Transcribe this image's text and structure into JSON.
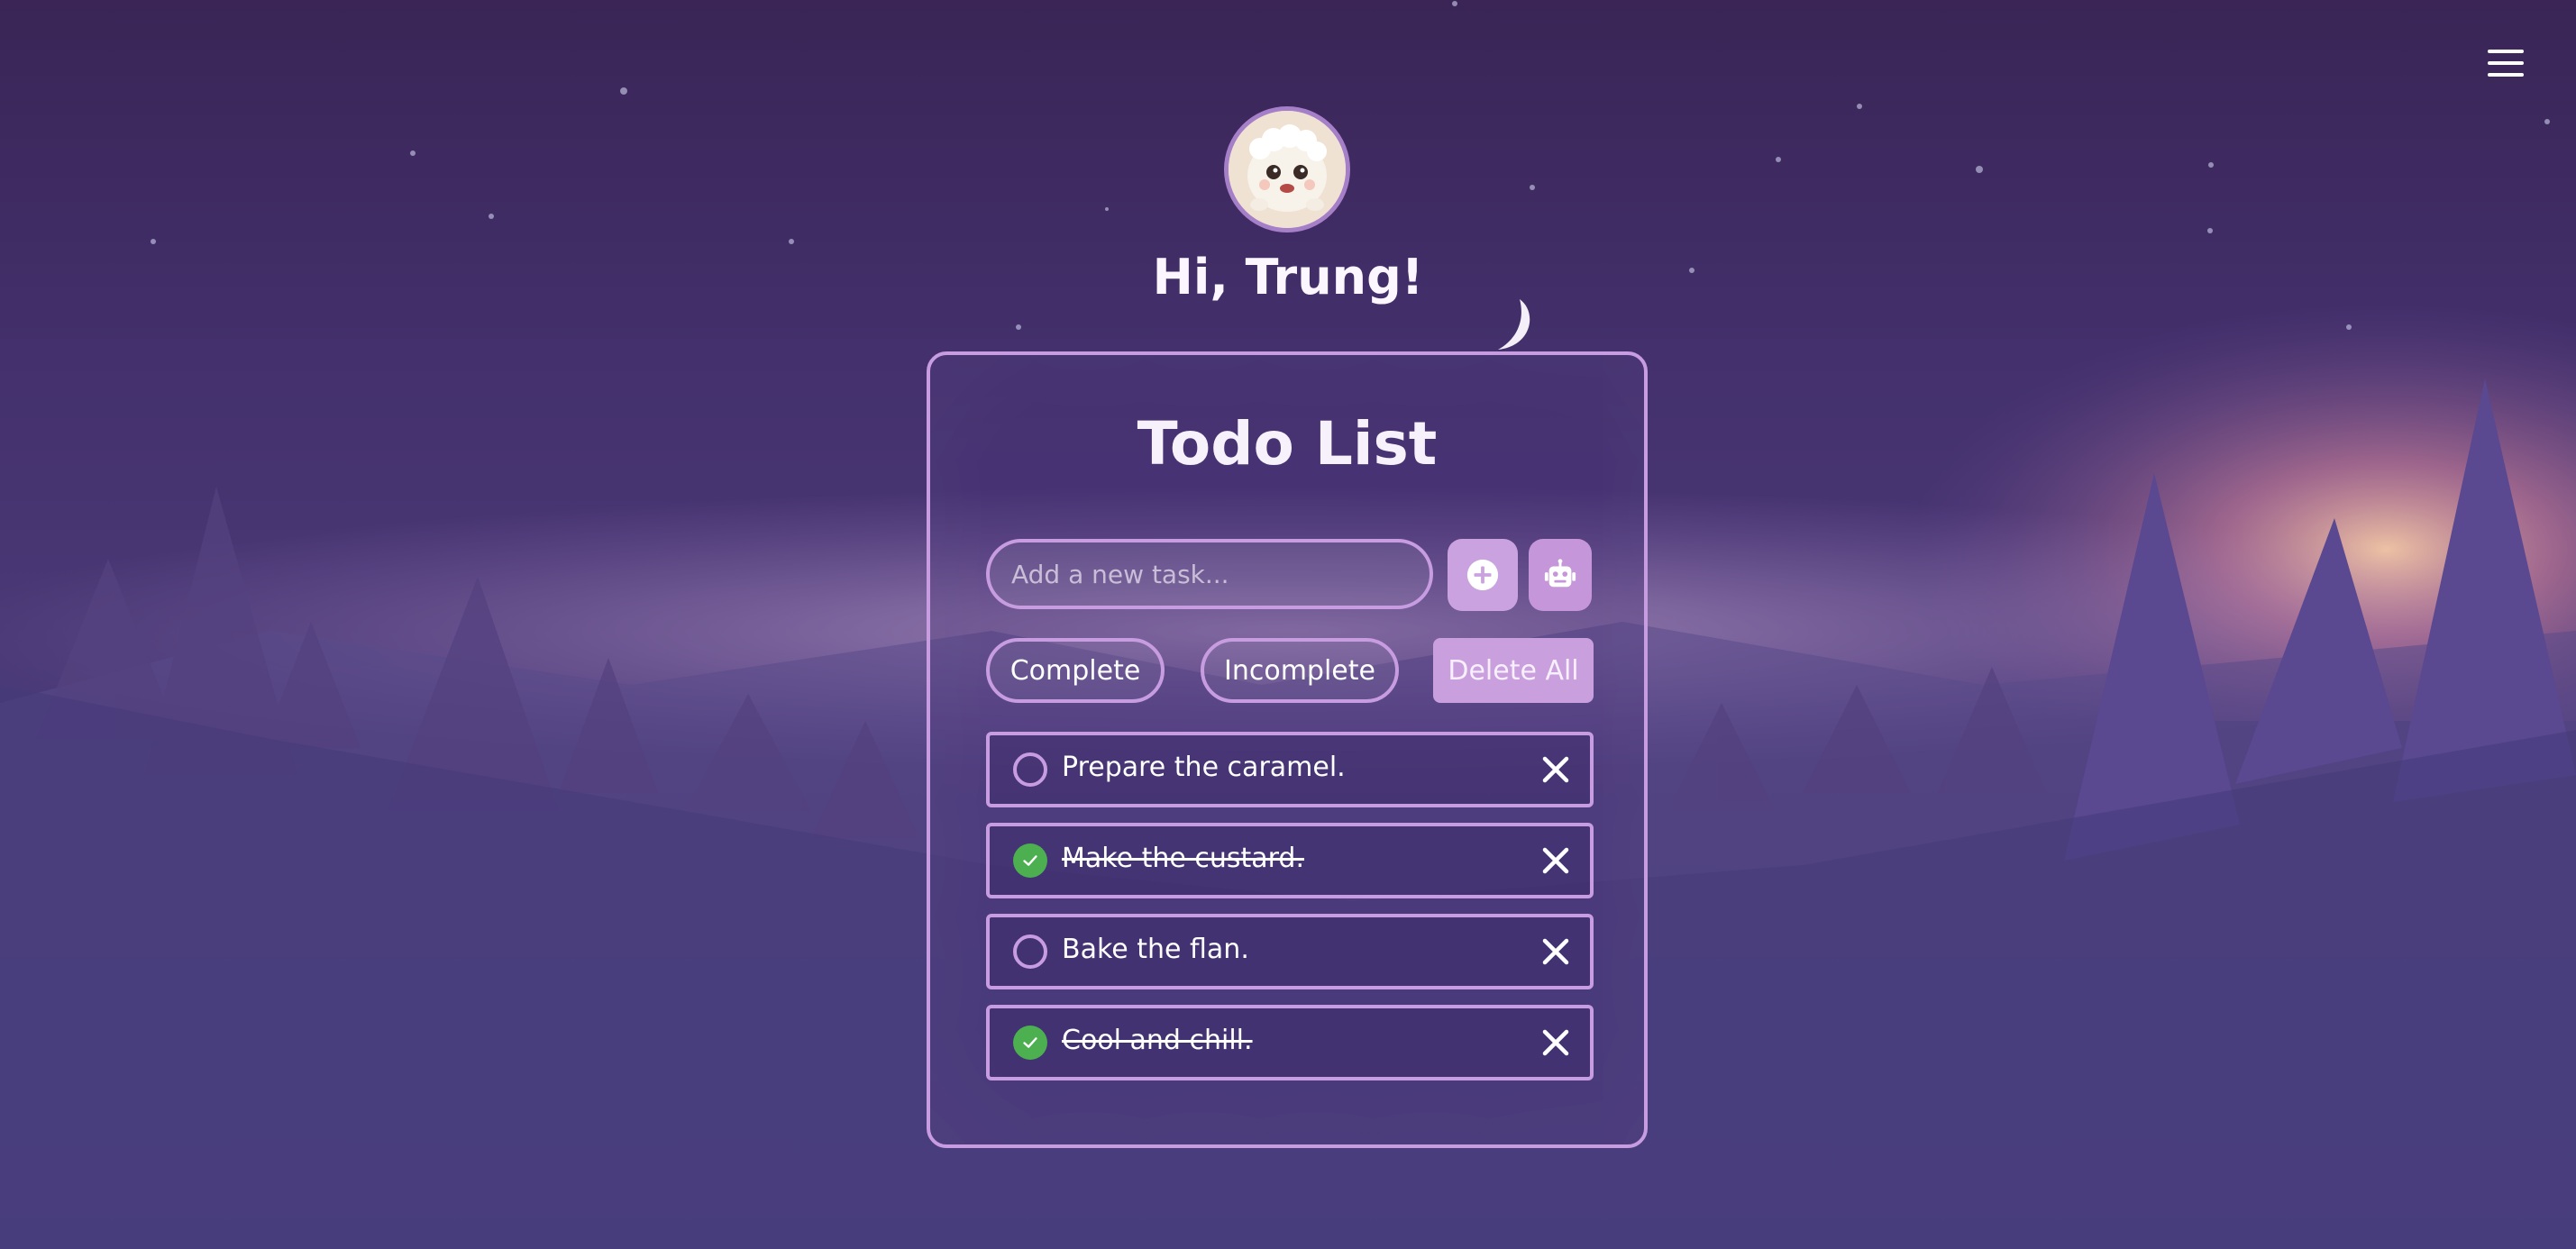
{
  "header": {
    "greeting": "Hi, Trung!",
    "menu_icon": "hamburger-icon"
  },
  "avatar": {
    "icon": "avatar-image"
  },
  "todo": {
    "title": "Todo List",
    "input_placeholder": "Add a new task...",
    "input_value": "",
    "add_icon": "plus-circle-icon",
    "ai_icon": "robot-icon"
  },
  "filters": {
    "complete_label": "Complete",
    "incomplete_label": "Incomplete",
    "delete_all_label": "Delete All"
  },
  "tasks": [
    {
      "text": "Prepare the caramel.",
      "completed": false
    },
    {
      "text": "Make the custard.",
      "completed": true
    },
    {
      "text": "Bake the flan.",
      "completed": false
    },
    {
      "text": "Cool and chill.",
      "completed": true
    }
  ],
  "colors": {
    "accent": "#c79ce0",
    "done_check": "#4caf50",
    "button_fill": "#c99fde"
  }
}
